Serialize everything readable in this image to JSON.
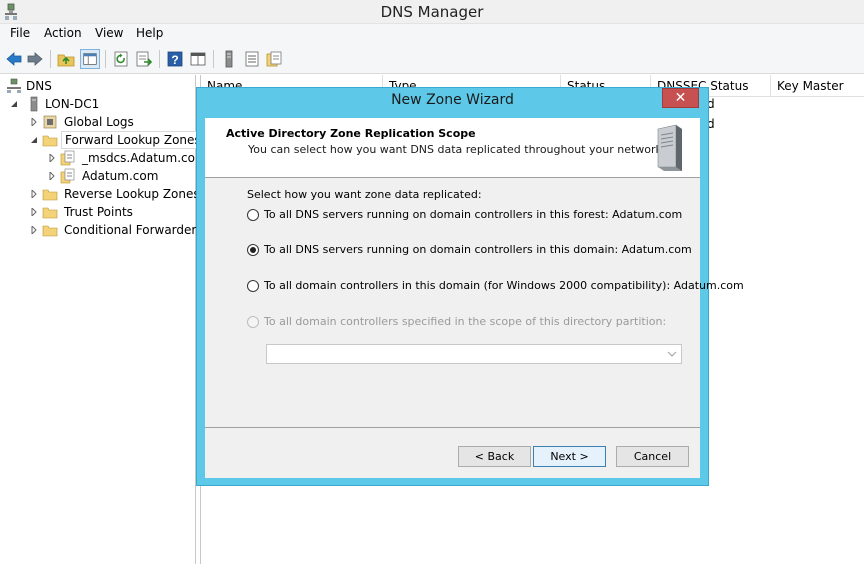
{
  "window": {
    "title": "DNS Manager"
  },
  "menu": [
    "File",
    "Action",
    "View",
    "Help"
  ],
  "toolbar": {
    "icons": [
      "back-arrow-icon",
      "forward-arrow-icon",
      "up-folder-icon",
      "show-hide-tree-icon",
      "refresh-icon",
      "export-list-icon",
      "help-icon",
      "properties-icon",
      "server-icon",
      "list-icon",
      "zone-icon"
    ]
  },
  "tree": {
    "root": "DNS",
    "server": "LON-DC1",
    "global_logs": "Global Logs",
    "forward_lookup_zones": "Forward Lookup Zones",
    "zone_msdcs": "_msdcs.Adatum.com",
    "zone_adatum": "Adatum.com",
    "reverse_lookup_zones": "Reverse Lookup Zones",
    "trust_points": "Trust Points",
    "conditional_forwarders": "Conditional Forwarders"
  },
  "list": {
    "columns": [
      "Name",
      "Type",
      "Status",
      "DNSSEC Status",
      "Key Master"
    ],
    "visible_cells": [
      "d",
      "d"
    ]
  },
  "wizard": {
    "title": "New Zone Wizard",
    "close_glyph": "✕",
    "header_title": "Active Directory Zone Replication Scope",
    "header_desc": "You can select how you want DNS data replicated throughout your network.",
    "prompt": "Select how you want zone data replicated:",
    "options": [
      "To all DNS servers running on domain controllers in this forest: Adatum.com",
      "To all DNS servers running on domain controllers in this domain: Adatum.com",
      "To all domain controllers in this domain (for Windows 2000 compatibility): Adatum.com",
      "To all domain controllers specified in the scope of this directory partition:"
    ],
    "selected_option": "To all DNS servers running on domain controllers in this domain: Adatum.com",
    "partition_value": "",
    "buttons": {
      "back": "< Back",
      "next": "Next >",
      "cancel": "Cancel"
    }
  },
  "colors": {
    "dialog_frame": "#5dc8e8",
    "close_button": "#c75050"
  }
}
